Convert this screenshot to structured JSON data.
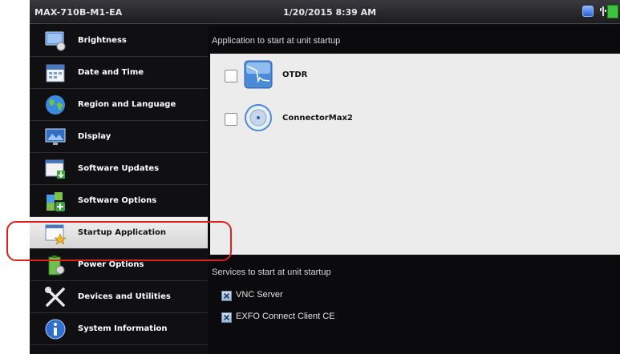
{
  "status_bar": {
    "unit_name": "MAX-710B-M1-EA",
    "datetime": "1/20/2015 8:39 AM"
  },
  "sidebar": {
    "items": [
      {
        "label": "Brightness",
        "icon": "brightness-icon"
      },
      {
        "label": "Date and Time",
        "icon": "calendar-icon"
      },
      {
        "label": "Region and Language",
        "icon": "globe-icon"
      },
      {
        "label": "Display",
        "icon": "monitor-icon"
      },
      {
        "label": "Software Updates",
        "icon": "software-update-icon"
      },
      {
        "label": "Software Options",
        "icon": "puzzle-icon"
      },
      {
        "label": "Startup Application",
        "icon": "startup-icon",
        "selected": true
      },
      {
        "label": "Power Options",
        "icon": "battery-icon"
      },
      {
        "label": "Devices and Utilities",
        "icon": "tools-icon"
      },
      {
        "label": "System Information",
        "icon": "info-icon"
      }
    ]
  },
  "main": {
    "applications_title": "Application to start at unit startup",
    "applications": [
      {
        "name": "OTDR",
        "checked": false,
        "icon": "otdr-icon"
      },
      {
        "name": "ConnectorMax2",
        "checked": false,
        "icon": "connectormax-icon"
      }
    ],
    "services_title": "Services to start at unit startup",
    "services": [
      {
        "name": "VNC Server",
        "checked": true
      },
      {
        "name": "EXFO Connect Client CE",
        "checked": true
      }
    ]
  },
  "colors": {
    "highlight": "#e02020",
    "background": "#0e0e10",
    "selected_item": "#e6e6e6",
    "app_panel": "#ececec"
  }
}
